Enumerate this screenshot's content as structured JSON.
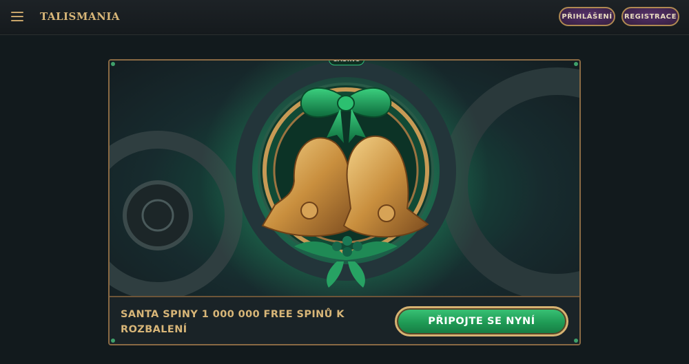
{
  "header": {
    "menu_icon": "hamburger-icon",
    "logo": "TALISMANIA",
    "login_label": "PŘIHLÁŠENÍ",
    "register_label": "REGISTRACE"
  },
  "promo": {
    "tag": "CASINO",
    "headline": "SANTA SPINY 1 000 000 FREE SPINŮ K ROZBALENÍ",
    "cta_label": "PŘIPOJTE SE NYNÍ",
    "artwork": "bells-icon"
  },
  "colors": {
    "background": "#121a1d",
    "gold": "#d8b678",
    "cta_green": "#2bb266",
    "header_button_purple": "#45284f"
  }
}
